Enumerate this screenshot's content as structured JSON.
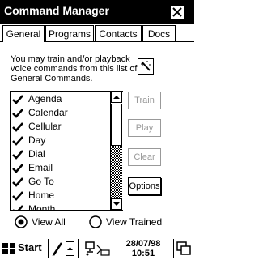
{
  "window": {
    "title": "Command Manager"
  },
  "tabs": [
    "General",
    "Programs",
    "Contacts",
    "Docs"
  ],
  "description": [
    "You may train and/or playback",
    "voice commands from this list of",
    "General Commands."
  ],
  "commands": [
    "Agenda",
    "Calendar",
    "Cellular",
    "Day",
    "Dial",
    "Email",
    "Go To",
    "Home",
    "Month"
  ],
  "buttons": {
    "train": "Train",
    "play": "Play",
    "clear": "Clear",
    "options": "Options"
  },
  "view": {
    "all": "View All",
    "trained": "View Trained",
    "selected": "all"
  },
  "taskbar": {
    "start": "Start",
    "date": "28/07/98",
    "time": "10:51"
  }
}
